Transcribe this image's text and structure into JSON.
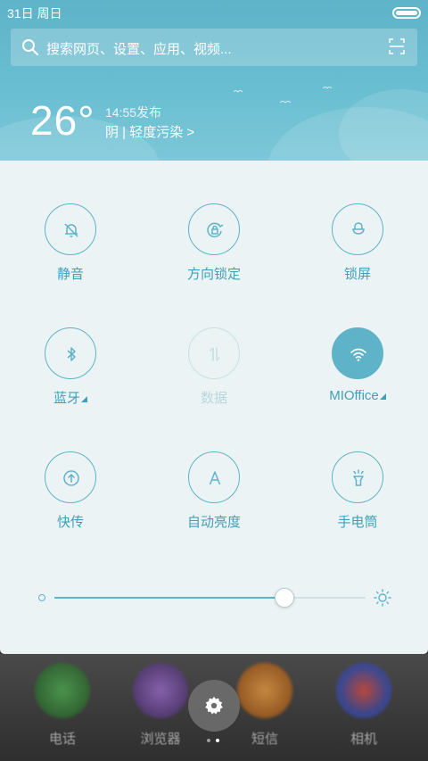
{
  "status_bar": {
    "date": "31日 周日"
  },
  "search": {
    "placeholder": "搜索网页、设置、应用、视频..."
  },
  "weather": {
    "temperature": "26°",
    "published": "14:55发布",
    "condition": "阴 | 轻度污染 >"
  },
  "toggles": [
    {
      "label": "静音",
      "icon": "bell-off-icon",
      "state": "off"
    },
    {
      "label": "方向锁定",
      "icon": "rotation-lock-icon",
      "state": "off"
    },
    {
      "label": "锁屏",
      "icon": "lock-icon",
      "state": "off"
    },
    {
      "label": "蓝牙",
      "icon": "bluetooth-icon",
      "state": "off",
      "has_menu": true
    },
    {
      "label": "数据",
      "icon": "data-arrows-icon",
      "state": "disabled"
    },
    {
      "label": "MIOffice",
      "icon": "wifi-icon",
      "state": "on",
      "has_menu": true
    },
    {
      "label": "快传",
      "icon": "share-upload-icon",
      "state": "off"
    },
    {
      "label": "自动亮度",
      "icon": "auto-brightness-icon",
      "state": "off"
    },
    {
      "label": "手电筒",
      "icon": "flashlight-icon",
      "state": "off"
    }
  ],
  "brightness": {
    "level": 0.74
  },
  "dock": {
    "apps": [
      {
        "label": "电话",
        "icon": "phone-icon",
        "color": "#3a8f3a"
      },
      {
        "label": "浏览器",
        "icon": "browser-icon",
        "color": "#7a4aa8"
      },
      {
        "label": "短信",
        "icon": "message-icon",
        "color": "#d9862a"
      },
      {
        "label": "相机",
        "icon": "camera-icon",
        "color": "#3a55b0"
      }
    ],
    "page_indicator": {
      "pages": 2,
      "current": 2
    }
  },
  "colors": {
    "accent": "#5fb3c8",
    "panel_bg": "#ebf3f4",
    "label": "#3fa0b8"
  }
}
